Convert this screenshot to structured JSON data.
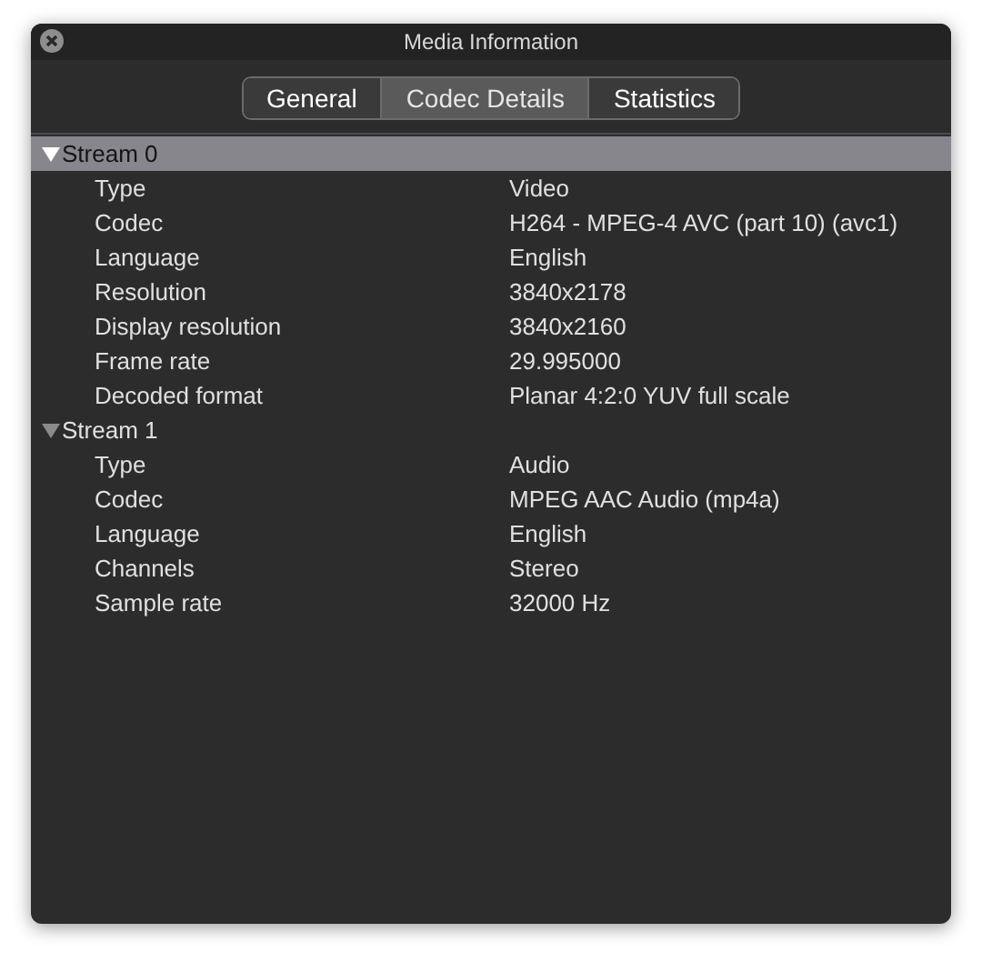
{
  "window": {
    "title": "Media Information"
  },
  "tabs": [
    {
      "label": "General",
      "selected": false
    },
    {
      "label": "Codec Details",
      "selected": true
    },
    {
      "label": "Statistics",
      "selected": false
    }
  ],
  "streams": [
    {
      "label": "Stream 0",
      "expanded": true,
      "selected": true,
      "properties": [
        {
          "name": "Type",
          "value": "Video"
        },
        {
          "name": "Codec",
          "value": "H264 - MPEG-4 AVC (part 10) (avc1)"
        },
        {
          "name": "Language",
          "value": "English"
        },
        {
          "name": "Resolution",
          "value": "3840x2178"
        },
        {
          "name": "Display resolution",
          "value": "3840x2160"
        },
        {
          "name": "Frame rate",
          "value": "29.995000"
        },
        {
          "name": "Decoded format",
          "value": "Planar 4:2:0 YUV full scale"
        }
      ]
    },
    {
      "label": "Stream 1",
      "expanded": true,
      "selected": false,
      "properties": [
        {
          "name": "Type",
          "value": "Audio"
        },
        {
          "name": "Codec",
          "value": "MPEG AAC Audio (mp4a)"
        },
        {
          "name": "Language",
          "value": "English"
        },
        {
          "name": "Channels",
          "value": "Stereo"
        },
        {
          "name": "Sample rate",
          "value": "32000 Hz"
        }
      ]
    }
  ]
}
